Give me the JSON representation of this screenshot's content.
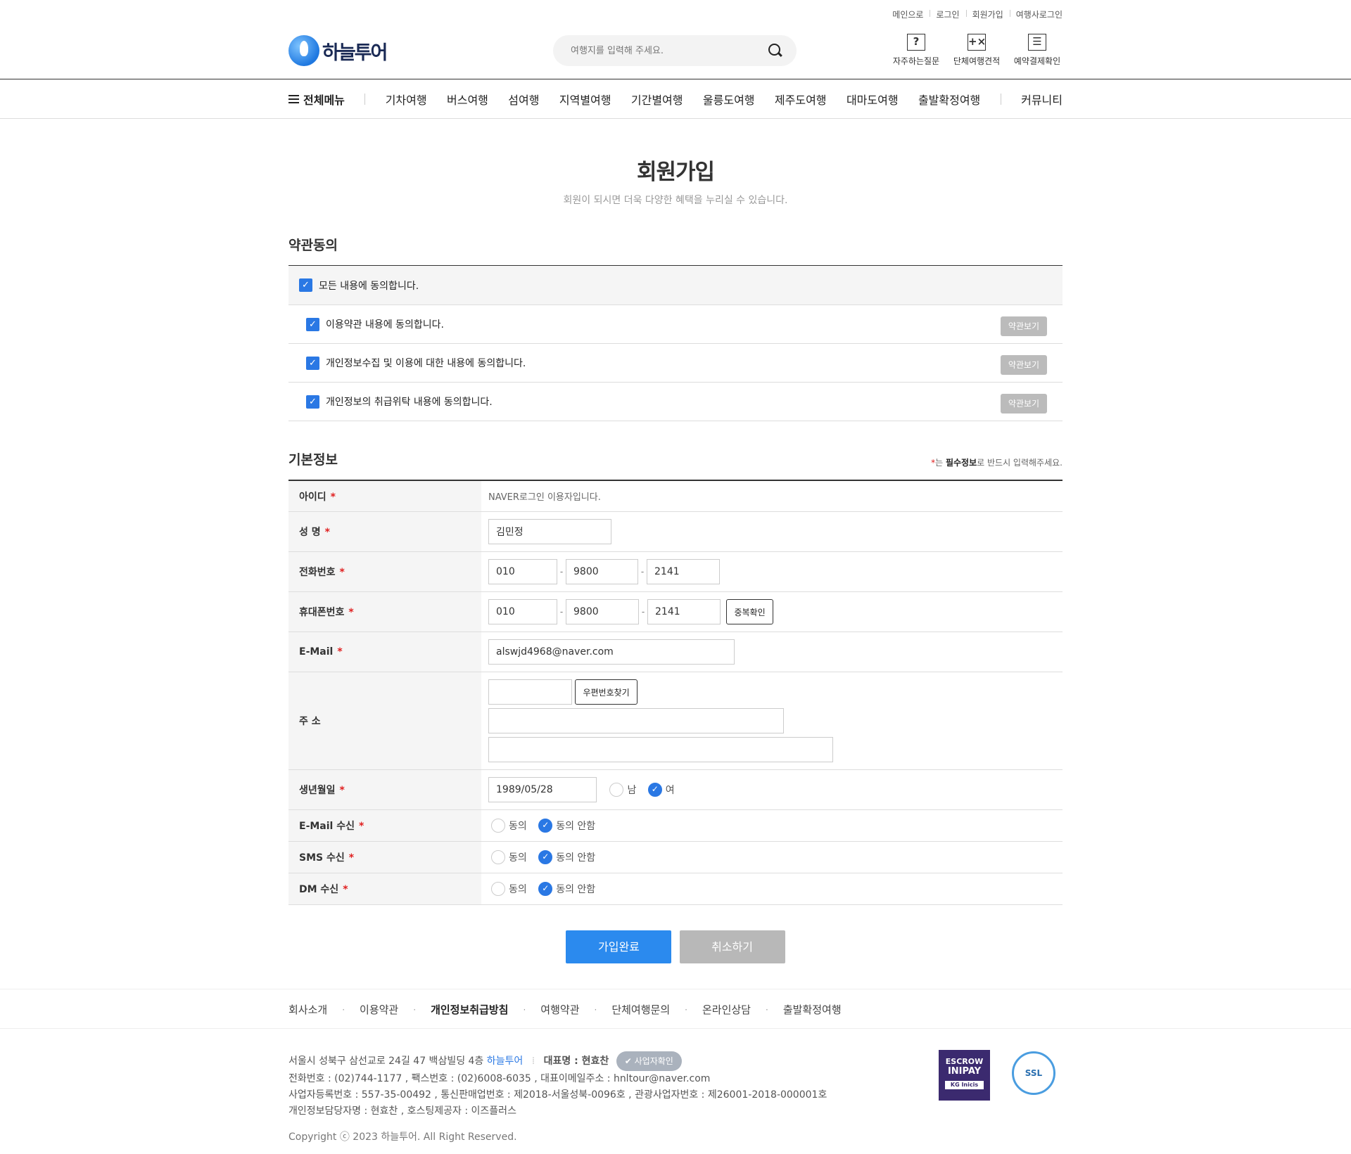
{
  "header": {
    "top_links": [
      "메인으로",
      "로그인",
      "회원가입",
      "여행사로그인"
    ],
    "logo_text": "하늘투어",
    "search_placeholder": "여행지를 입력해 주세요.",
    "quick": [
      {
        "icon": "question-icon",
        "glyph": "?",
        "label": "자주하는질문"
      },
      {
        "icon": "calculator-icon",
        "glyph": "+×",
        "label": "단체여행견적"
      },
      {
        "icon": "monitor-icon",
        "glyph": "☰",
        "label": "예약결제확인"
      }
    ]
  },
  "gnb": {
    "all_menu": "전체메뉴",
    "items": [
      "기차여행",
      "버스여행",
      "섬여행",
      "지역별여행",
      "기간별여행",
      "울릉도여행",
      "제주도여행",
      "대마도여행",
      "출발확정여행",
      "커뮤니티"
    ]
  },
  "page": {
    "title": "회원가입",
    "subtitle": "회원이 되시면 더욱 다양한 혜택을 누리실 수 있습니다."
  },
  "terms": {
    "heading": "약관동의",
    "all": "모든 내용에 동의합니다.",
    "items": [
      {
        "label": "이용약관 내용에 동의합니다.",
        "button": "약관보기"
      },
      {
        "label": "개인정보수집 및 이용에 대한 내용에 동의합니다.",
        "button": "약관보기"
      },
      {
        "label": "개인정보의 취급위탁 내용에 동의합니다.",
        "button": "약관보기"
      }
    ]
  },
  "basic": {
    "heading": "기본정보",
    "note_prefix": "는 ",
    "note_bold": "필수정보",
    "note_suffix": "로 반드시 입력해주세요.",
    "id_label": "아이디",
    "id_value": "NAVER로그인 이용자입니다.",
    "name_label": "성 명",
    "name_value": "김민정",
    "phone_label": "전화번호",
    "phone": [
      "010",
      "9800",
      "2141"
    ],
    "mobile_label": "휴대폰번호",
    "mobile": [
      "010",
      "9800",
      "2141"
    ],
    "dup_button": "중복확인",
    "email_label": "E-Mail",
    "email_value": "alswjd4968@naver.com",
    "address_label": "주 소",
    "zip_button": "우편번호찾기",
    "birth_label": "생년월일",
    "birth_value": "1989/05/28",
    "male": "남",
    "female": "여",
    "email_recv_label": "E-Mail 수신",
    "sms_recv_label": "SMS 수신",
    "dm_recv_label": "DM 수신",
    "agree": "동의",
    "disagree": "동의 안함"
  },
  "actions": {
    "submit": "가입완료",
    "cancel": "취소하기"
  },
  "footer": {
    "nav": [
      "회사소개",
      "이용약관",
      "개인정보취급방침",
      "여행약관",
      "단체여행문의",
      "온라인상담",
      "출발확정여행"
    ],
    "address_prefix": "서울시 성북구 삼선교로 24길 47 백삼빌딩 4층",
    "company": "하늘투어",
    "ceo": "대표명 : 현효찬",
    "biz_badge": "사업자확인",
    "line2": "전화번호 : (02)744-1177 , 팩스번호 : (02)6008-6035 , 대표이메일주소 : hnltour@naver.com",
    "line3": "사업자등록번호 : 557-35-00492 , 통신판매업번호 : 제2018-서울성북-0096호 , 관광사업자번호 : 제26001-2018-000001호",
    "line4": "개인정보담당자명 : 현효찬 , 호스팅제공자 : 이즈플러스",
    "copyright": "Copyright ⓒ 2023 하늘투어. All Right Reserved.",
    "escrow_l1": "ESCROW",
    "escrow_l2": "INIPAY",
    "escrow_l3": "KG Inicis",
    "ssl": "SSL"
  },
  "colors": {
    "accent": "#2b8aee",
    "check": "#2a78e4",
    "required": "#e02020"
  }
}
